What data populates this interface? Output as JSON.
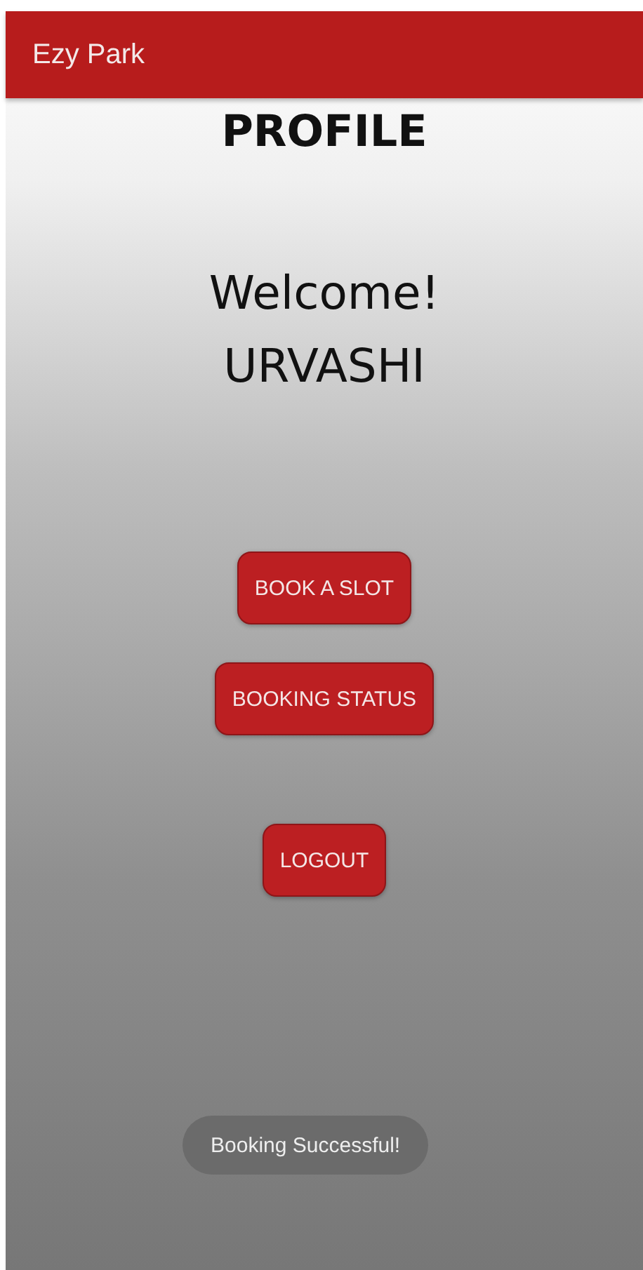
{
  "app_bar": {
    "title": "Ezy Park"
  },
  "heading": "PROFILE",
  "welcome": {
    "greeting": "Welcome!",
    "name": "URVASHI"
  },
  "button_groups": [
    {
      "buttons": [
        "BOOK A SLOT",
        "BOOKING STATUS"
      ]
    },
    {
      "buttons": [
        "LOGOUT"
      ]
    }
  ],
  "toast": "Booking Successful!"
}
